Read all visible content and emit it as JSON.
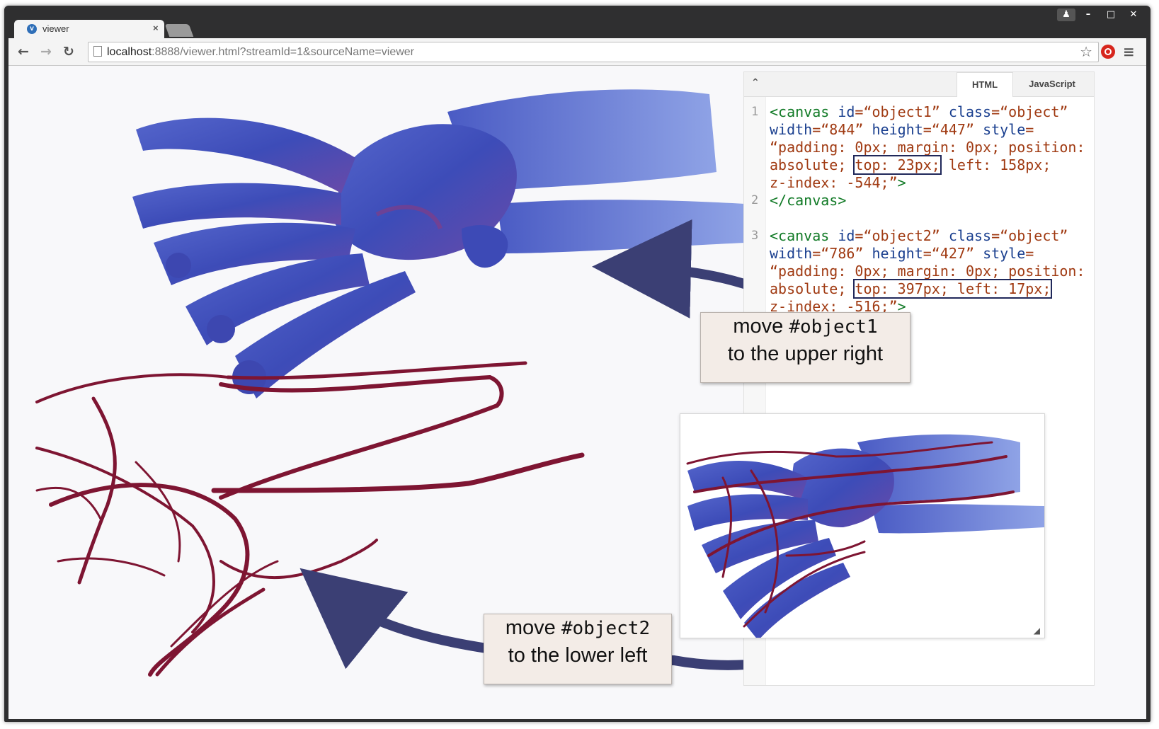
{
  "browser": {
    "tab_title": "viewer",
    "tab_close": "×",
    "url_host": "localhost",
    "url_rest": ":8888/viewer.html?streamId=1&sourceName=viewer",
    "back": "←",
    "forward": "→",
    "reload": "↻",
    "star": "☆",
    "menu": "≡",
    "win_user": "♟",
    "win_min": "–",
    "win_max": "□",
    "win_close": "✕",
    "favicon": "v"
  },
  "editor": {
    "collapse": "⌃",
    "tabs": [
      "HTML",
      "JavaScript"
    ],
    "active_tab": "HTML",
    "lines": [
      {
        "n": "1",
        "parts": [
          [
            "tagc",
            "<canvas "
          ],
          [
            "attr",
            "id"
          ],
          [
            "t",
            "=“object1” "
          ],
          [
            "attr",
            "class"
          ],
          [
            "t",
            "=“object”"
          ]
        ]
      },
      {
        "n": "",
        "parts": [
          [
            "attr",
            "width"
          ],
          [
            "t",
            "=“844” "
          ],
          [
            "attr",
            "height"
          ],
          [
            "t",
            "=“447” "
          ],
          [
            "attr",
            "style"
          ],
          [
            "t",
            "="
          ]
        ]
      },
      {
        "n": "",
        "parts": [
          [
            "t",
            "“padding: 0px; margin: 0px; position:"
          ]
        ]
      },
      {
        "n": "",
        "parts": [
          [
            "t",
            "absolute; "
          ],
          [
            "hl",
            "top: 23px;"
          ],
          [
            "t",
            " left: 158px;"
          ]
        ]
      },
      {
        "n": "",
        "parts": [
          [
            "t",
            "z-index: -544;”"
          ],
          [
            "tagc",
            ">"
          ]
        ]
      },
      {
        "n": "2",
        "parts": [
          [
            "tagc",
            "</canvas>"
          ]
        ]
      },
      {
        "n": "",
        "parts": [
          [
            "t",
            ""
          ]
        ]
      },
      {
        "n": "3",
        "parts": [
          [
            "tagc",
            "<canvas "
          ],
          [
            "attr",
            "id"
          ],
          [
            "t",
            "=“object2” "
          ],
          [
            "attr",
            "class"
          ],
          [
            "t",
            "=“object”"
          ]
        ]
      },
      {
        "n": "",
        "parts": [
          [
            "attr",
            "width"
          ],
          [
            "t",
            "=“786” "
          ],
          [
            "attr",
            "height"
          ],
          [
            "t",
            "=“427” "
          ],
          [
            "attr",
            "style"
          ],
          [
            "t",
            "="
          ]
        ]
      },
      {
        "n": "",
        "parts": [
          [
            "t",
            "“padding: 0px; margin: 0px; position:"
          ]
        ]
      },
      {
        "n": "",
        "parts": [
          [
            "t",
            "absolute; "
          ],
          [
            "hl",
            "top: 397px; left: 17px;"
          ]
        ]
      },
      {
        "n": "",
        "parts": [
          [
            "t",
            "z-index: -516;”"
          ],
          [
            "tagc",
            ">"
          ]
        ]
      }
    ]
  },
  "callouts": {
    "upper": {
      "verb": "move ",
      "target": "#object1",
      "rest": "to the upper right"
    },
    "lower": {
      "verb": "move ",
      "target": "#object2",
      "rest": "to the lower left"
    }
  },
  "preview": {
    "resize_handle": "◢"
  },
  "colors": {
    "bone": "#4a5bc4",
    "bone_dark": "#2f3a96",
    "bone_highlight": "#8fa3e6",
    "vessel": "#7e1532",
    "arrow": "#3b3f74",
    "chrome": "#2f2f30"
  }
}
